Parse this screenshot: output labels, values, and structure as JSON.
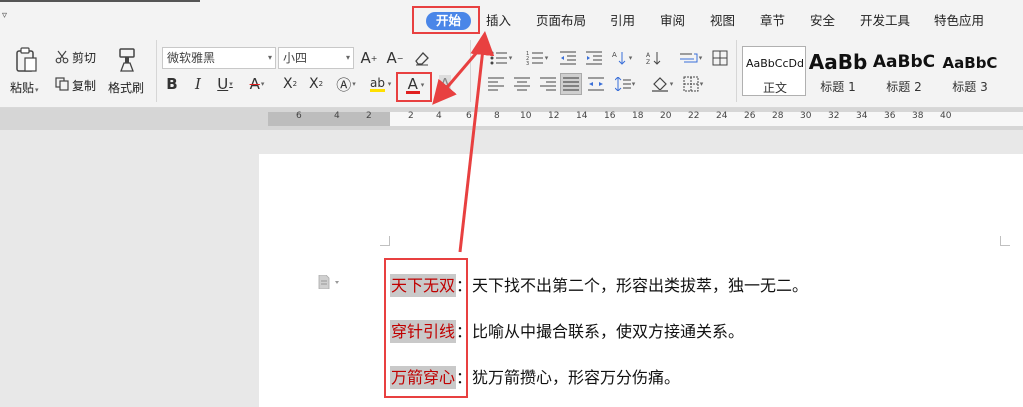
{
  "menu": {
    "toggle_icon": "chevron-down-icon",
    "tabs": [
      "开始",
      "插入",
      "页面布局",
      "引用",
      "审阅",
      "视图",
      "章节",
      "安全",
      "开发工具",
      "特色应用"
    ],
    "active_tab": "开始"
  },
  "ribbon": {
    "paste_label": "粘贴",
    "cut_label": "剪切",
    "copy_label": "复制",
    "format_painter_label": "格式刷",
    "font_name": "微软雅黑",
    "font_size": "小四",
    "font_color_letter": "A",
    "highlight_letter": "A",
    "styles": [
      {
        "sample": "AaBbCcDd",
        "name": "正文"
      },
      {
        "sample": "AaBb",
        "name": "标题 1"
      },
      {
        "sample": "AaBbC",
        "name": "标题 2"
      },
      {
        "sample": "AaBbC",
        "name": "标题 3"
      }
    ],
    "font_color_hex": "#e02020"
  },
  "ruler": {
    "numbers": [
      "6",
      "4",
      "2",
      "2",
      "4",
      "6",
      "8",
      "10",
      "12",
      "14",
      "16",
      "18",
      "20",
      "22",
      "24",
      "26",
      "28",
      "30",
      "32",
      "34",
      "36",
      "38",
      "40"
    ]
  },
  "document": {
    "lines": [
      {
        "term": "天下无双",
        "desc": "：天下找不出第二个，形容出类拔萃，独一无二。"
      },
      {
        "term": "穿针引线",
        "desc": "：比喻从中撮合联系，使双方接通关系。"
      },
      {
        "term": "万箭穿心",
        "desc": "：犹万箭攒心，形容万分伤痛。"
      }
    ],
    "term_color": "#c00000"
  },
  "annotation_color": "#e84040"
}
